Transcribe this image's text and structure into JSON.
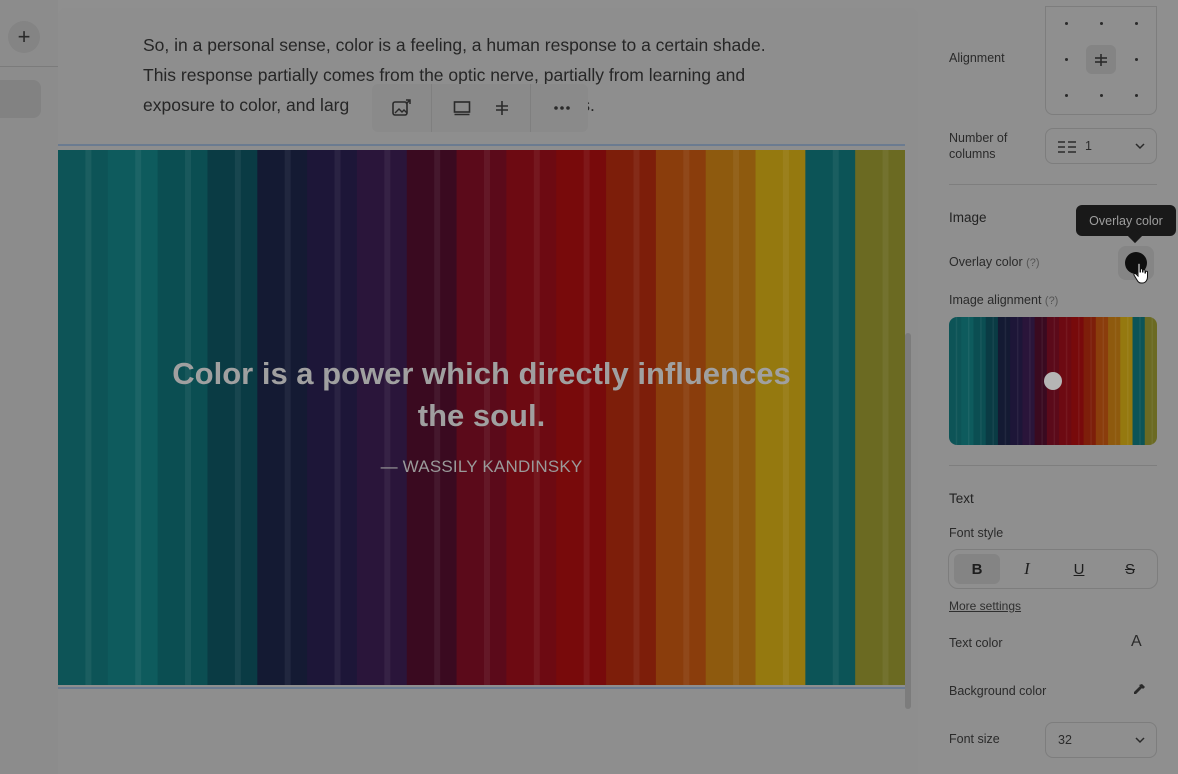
{
  "editor": {
    "paragraph_lines": [
      "So, in a personal sense, color is a feeling, a human response to a certain shade.",
      "This response partially comes from the optic nerve, partially from learning and",
      "exposure to color, and larg",
      "s."
    ],
    "quote": {
      "line1": "Color is a power which directly influences",
      "line2": "the soul.",
      "author": "— WASSILY KANDINSKY"
    },
    "image_stripe_colors": [
      "#0d5457",
      "#0e5b5d",
      "#0b4e52",
      "#0a3b44",
      "#141a33",
      "#1d1638",
      "#2a153a",
      "#3a0a20",
      "#5b0a1a",
      "#6d0a12",
      "#780a0b",
      "#7d1e0a",
      "#8a3d0c",
      "#8e5a0e",
      "#95790f",
      "#0c5457",
      "#6b6a22"
    ]
  },
  "panel": {
    "alignment_label": "Alignment",
    "columns_label": "Number of columns",
    "columns_value": "1",
    "image_heading": "Image",
    "overlay_label": "Overlay color",
    "help_mark": "(?)",
    "image_alignment_label": "Image alignment",
    "text_heading": "Text",
    "font_style_label": "Font style",
    "font_style_buttons": [
      "B",
      "I",
      "U",
      "S"
    ],
    "more_settings_label": "More settings",
    "text_color_label": "Text color",
    "text_color_glyph": "A",
    "background_color_label": "Background color",
    "font_size_label": "Font size",
    "font_size_value": "32",
    "tooltip": "Overlay color",
    "overlay_swatch_color": "#0f0f0f"
  },
  "left_rail": {
    "add_glyph": "+"
  }
}
